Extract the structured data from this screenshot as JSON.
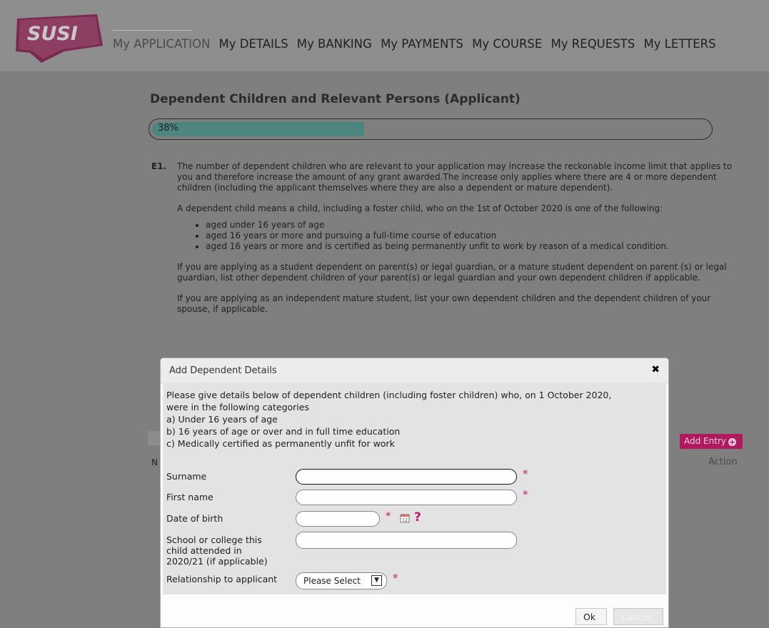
{
  "header": {
    "logo_text": "SUSI",
    "nav": [
      {
        "label": "My APPLICATION",
        "active": true
      },
      {
        "label": "My DETAILS"
      },
      {
        "label": "My BANKING"
      },
      {
        "label": "My PAYMENTS"
      },
      {
        "label": "My COURSE"
      },
      {
        "label": "My REQUESTS"
      },
      {
        "label": "My LETTERS"
      }
    ]
  },
  "page": {
    "title": "Dependent Children and Relevant Persons (Applicant)",
    "progress_text": "38%",
    "progress_value": 0.38,
    "question_label": "E1.",
    "paragraph1": "The number of dependent children who are relevant to your application may increase the reckonable income limit that applies to you and therefore increase the amount of any grant awarded.The increase only applies where there are 4 or more dependent children (including the applicant themselves where they are also a dependent or mature dependent).",
    "paragraph2": "A dependent child means a child, including a foster child, who on the 1st of October 2020 is one of the following:",
    "bullets": [
      "aged under 16 years of age",
      "aged 16 years or more and pursuing a full-time course of education",
      "aged 16 years or more and is certified as being permanently unfit to work by reason of a medical condition."
    ],
    "paragraph3": "If you are applying as a student dependent on parent(s) or legal guardian, or a mature student dependent on parent (s) or legal guardian, list other dependent children of your parent(s) or legal guardian and your own dependent children if applicable.",
    "paragraph4": "If you are applying as an independent mature student, list your own dependent children and the dependent children of your spouse, if applicable.",
    "add_entry_label": "Add Entry",
    "table_col_first": "N",
    "table_col_action": "Action"
  },
  "modal": {
    "title": "Add Dependent Details",
    "close_glyph": "✖",
    "intro_lines": [
      "Please give details below of dependent children (including foster children) who, on 1 October 2020,",
      "were in the following categories",
      "a) Under 16 years of age",
      "b) 16 years of age or over and in full time education",
      "c) Medically certified as permanently unfit for work"
    ],
    "fields": {
      "surname_label": "Surname",
      "surname_value": "",
      "first_name_label": "First name",
      "first_name_value": "",
      "dob_label": "Date of birth",
      "dob_value": "",
      "school_label": "School or college this child attended in 2020/21 (if applicable)",
      "school_value": "",
      "relationship_label": "Relationship to applicant",
      "relationship_selected": "Please Select"
    },
    "required_marker": "*",
    "help_marker": "?",
    "ok_label": "Ok",
    "cancel_label": "Cancel"
  },
  "colors": {
    "accent": "#b0195e",
    "progress_fill": "#4d8680",
    "required": "#d0196f"
  },
  "icons": [
    "logo-shape",
    "plus-circle-icon",
    "close-icon",
    "calendar-icon",
    "help-icon",
    "chevron-down-icon"
  ]
}
